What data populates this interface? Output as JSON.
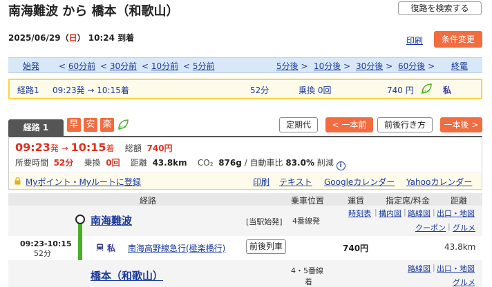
{
  "header": {
    "title": "南海難波 から 橋本（和歌山）",
    "revsearch": "復路を検索する",
    "date": "2025/06/29（",
    "dow": "日",
    "time": "）  10:24 到着",
    "print": "印刷",
    "cond": "条件変更"
  },
  "timenav": {
    "first": "始発",
    "m60": "60分前",
    "m30": "30分前",
    "m10": "10分前",
    "m5": "5分前",
    "p5": "5分後",
    "p10": "10分後",
    "p30": "30分後",
    "p60": "60分後",
    "last": "終電"
  },
  "summary": {
    "route": "経路1",
    "time": "09:23発 → 10:15着",
    "dur": "52分",
    "transfer": "乗換 0回",
    "fare": "740 円",
    "shi": "私"
  },
  "routetab": {
    "label": "経路 1",
    "b1": "早",
    "b2": "安",
    "b3": "楽",
    "teiki": "定期代",
    "prev": "一本前",
    "around": "前後行き方",
    "next": "一本後"
  },
  "detail": {
    "dep": "09:23",
    "dep_s": "発 → ",
    "arr": "10:15",
    "arr_s": "着",
    "total_lbl": "総額",
    "total": "740円",
    "req_lbl": "所要時間",
    "req": "52分",
    "tr_lbl": "乗換",
    "tr": "0回",
    "dist_lbl": "距離",
    "dist": "43.8km",
    "co2_lbl": "CO₂",
    "co2": "876g",
    "co2_rest": " / 自動車比 ",
    "co2_pct": "83.0%",
    "co2_end": " 削減",
    "info": "i"
  },
  "links": {
    "mypoint": "Myポイント・Myルートに登録",
    "print": "印刷",
    "text": "テキスト",
    "gcal": "Googleカレンダー",
    "ycal": "Yahooカレンダー"
  },
  "table": {
    "h_route": "経路",
    "h_pos": "乗車位置",
    "h_fare": "運賃",
    "h_seat": "指定席/料金",
    "h_dist": "距離"
  },
  "st1": {
    "name": "南海難波",
    "note": "[当駅始発]",
    "pos": "4番線発",
    "l1": "時刻表",
    "l2": "構内図",
    "l3": "路線図",
    "l4": "出口・地図",
    "l5": "クーポン",
    "l6": "グルメ"
  },
  "seg": {
    "time": "09:23-10:15",
    "dur": "52分",
    "shi": "私",
    "line": "南海高野線急行(極楽橋行)",
    "around": "前後列車",
    "fare": "740円",
    "dist": "43.8km"
  },
  "st2": {
    "name": "橋本（和歌山）",
    "pos1": "4・5番線",
    "pos2": "着",
    "l1": "路線図",
    "l2": "出口・地図",
    "l3": "グルメ"
  },
  "colors": {
    "accent": "#f26c40",
    "link": "#1a3a9a",
    "rail": "#4cae24",
    "highlight": "#ffd23f"
  }
}
